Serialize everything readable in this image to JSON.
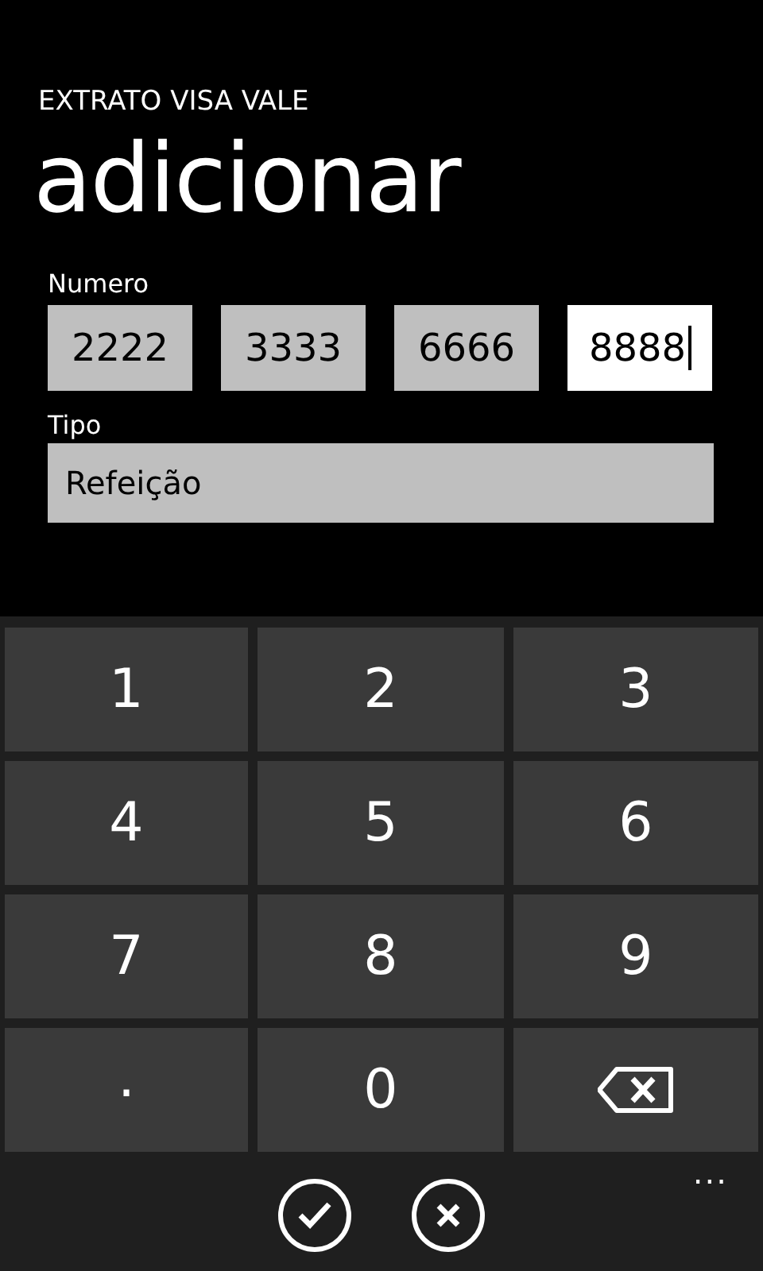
{
  "app_title": "EXTRATO VISA VALE",
  "page_title": "adicionar",
  "number": {
    "label": "Numero",
    "fields": [
      {
        "value": "2222",
        "focused": false
      },
      {
        "value": "3333",
        "focused": false
      },
      {
        "value": "6666",
        "focused": false
      },
      {
        "value": "8888",
        "focused": true
      }
    ]
  },
  "type": {
    "label": "Tipo",
    "value": "Refeição"
  },
  "keypad": [
    {
      "kind": "char",
      "label": "1"
    },
    {
      "kind": "char",
      "label": "2"
    },
    {
      "kind": "char",
      "label": "3"
    },
    {
      "kind": "char",
      "label": "4"
    },
    {
      "kind": "char",
      "label": "5"
    },
    {
      "kind": "char",
      "label": "6"
    },
    {
      "kind": "char",
      "label": "7"
    },
    {
      "kind": "char",
      "label": "8"
    },
    {
      "kind": "char",
      "label": "9"
    },
    {
      "kind": "char",
      "label": "."
    },
    {
      "kind": "char",
      "label": "0"
    },
    {
      "kind": "backspace"
    }
  ],
  "app_bar": {
    "buttons": [
      {
        "kind": "check"
      },
      {
        "kind": "cancel"
      }
    ],
    "more": "..."
  }
}
